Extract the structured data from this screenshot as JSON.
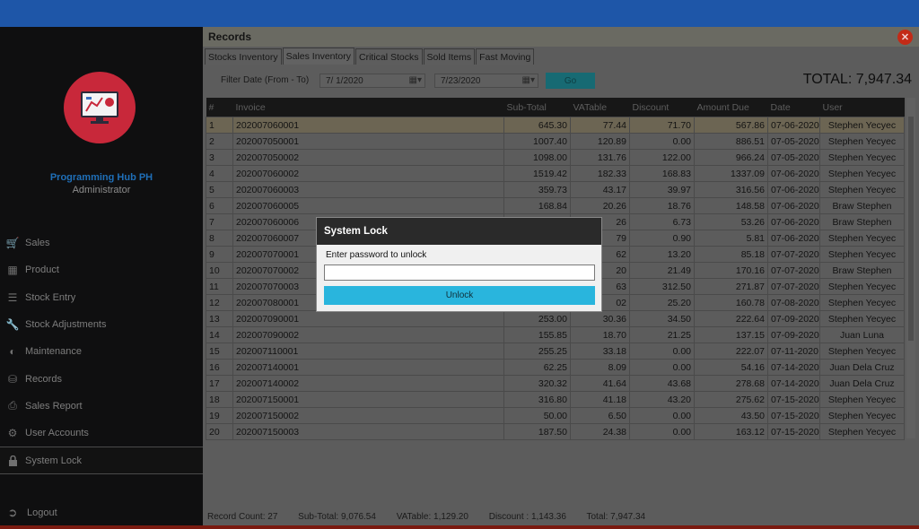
{
  "brand": {
    "name": "Programming Hub PH",
    "role": "Administrator"
  },
  "sidebar": {
    "items": [
      {
        "label": "Sales",
        "icon": "cart-icon"
      },
      {
        "label": "Product",
        "icon": "box-icon"
      },
      {
        "label": "Stock Entry",
        "icon": "stack-icon"
      },
      {
        "label": "Stock Adjustments",
        "icon": "wrench-icon"
      },
      {
        "label": "Maintenance",
        "icon": "gauge-icon"
      },
      {
        "label": "Records",
        "icon": "database-icon"
      },
      {
        "label": "Sales Report",
        "icon": "printer-icon"
      },
      {
        "label": "User Accounts",
        "icon": "users-cog-icon"
      },
      {
        "label": "System Lock",
        "icon": "lock-icon",
        "active": true
      }
    ],
    "logout": "Logout"
  },
  "records": {
    "title": "Records",
    "tabs": [
      "Stocks Inventory",
      "Sales Inventory",
      "Critical Stocks",
      "Sold Items",
      "Fast Moving"
    ],
    "active_tab": "Sales Inventory",
    "filter": {
      "label": "Filter Date (From - To)",
      "from": "7/  1/2020",
      "to": "7/23/2020",
      "go_label": "Go"
    },
    "total": "TOTAL: 7,947.34",
    "columns": [
      "#",
      "Invoice",
      "Sub-Total",
      "VATable",
      "Discount",
      "Amount Due",
      "Date",
      "User"
    ],
    "rows": [
      [
        "1",
        "202007060001",
        "645.30",
        "77.44",
        "71.70",
        "567.86",
        "07-06-2020",
        "Stephen Yecyec"
      ],
      [
        "2",
        "202007050001",
        "1007.40",
        "120.89",
        "0.00",
        "886.51",
        "07-05-2020",
        "Stephen Yecyec"
      ],
      [
        "3",
        "202007050002",
        "1098.00",
        "131.76",
        "122.00",
        "966.24",
        "07-05-2020",
        "Stephen Yecyec"
      ],
      [
        "4",
        "202007060002",
        "1519.42",
        "182.33",
        "168.83",
        "1337.09",
        "07-06-2020",
        "Stephen Yecyec"
      ],
      [
        "5",
        "202007060003",
        "359.73",
        "43.17",
        "39.97",
        "316.56",
        "07-06-2020",
        "Stephen Yecyec"
      ],
      [
        "6",
        "202007060005",
        "168.84",
        "20.26",
        "18.76",
        "148.58",
        "07-06-2020",
        "Braw Stephen"
      ],
      [
        "7",
        "202007060006",
        "",
        "26",
        "6.73",
        "53.26",
        "07-06-2020",
        "Braw Stephen"
      ],
      [
        "8",
        "202007060007",
        "",
        "79",
        "0.90",
        "5.81",
        "07-06-2020",
        "Stephen Yecyec"
      ],
      [
        "9",
        "202007070001",
        "",
        "62",
        "13.20",
        "85.18",
        "07-07-2020",
        "Stephen Yecyec"
      ],
      [
        "10",
        "202007070002",
        "",
        "20",
        "21.49",
        "170.16",
        "07-07-2020",
        "Braw Stephen"
      ],
      [
        "11",
        "202007070003",
        "",
        "63",
        "312.50",
        "271.87",
        "07-07-2020",
        "Stephen Yecyec"
      ],
      [
        "12",
        "202007080001",
        "",
        "02",
        "25.20",
        "160.78",
        "07-08-2020",
        "Stephen Yecyec"
      ],
      [
        "13",
        "202007090001",
        "253.00",
        "30.36",
        "34.50",
        "222.64",
        "07-09-2020",
        "Stephen Yecyec"
      ],
      [
        "14",
        "202007090002",
        "155.85",
        "18.70",
        "21.25",
        "137.15",
        "07-09-2020",
        "Juan Luna"
      ],
      [
        "15",
        "202007110001",
        "255.25",
        "33.18",
        "0.00",
        "222.07",
        "07-11-2020",
        "Stephen Yecyec"
      ],
      [
        "16",
        "202007140001",
        "62.25",
        "8.09",
        "0.00",
        "54.16",
        "07-14-2020",
        "Juan Dela Cruz"
      ],
      [
        "17",
        "202007140002",
        "320.32",
        "41.64",
        "43.68",
        "278.68",
        "07-14-2020",
        "Juan Dela Cruz"
      ],
      [
        "18",
        "202007150001",
        "316.80",
        "41.18",
        "43.20",
        "275.62",
        "07-15-2020",
        "Stephen Yecyec"
      ],
      [
        "19",
        "202007150002",
        "50.00",
        "6.50",
        "0.00",
        "43.50",
        "07-15-2020",
        "Stephen Yecyec"
      ],
      [
        "20",
        "202007150003",
        "187.50",
        "24.38",
        "0.00",
        "163.12",
        "07-15-2020",
        "Stephen Yecyec"
      ]
    ],
    "footer": {
      "record_count": "Record Count: 27",
      "sub_total": "Sub-Total: 9,076.54",
      "vatable": "VATable: 1,129.20",
      "discount": "Discount : 1,143.36",
      "total": "Total: 7,947.34"
    }
  },
  "dialog": {
    "title": "System Lock",
    "label": "Enter password to unlock",
    "password_value": "",
    "button_label": "Unlock"
  },
  "colors": {
    "topbar": "#1e56a8",
    "logo_circle": "#c8283a",
    "unlock_button": "#29b5dd",
    "close_button": "#c32a17"
  }
}
